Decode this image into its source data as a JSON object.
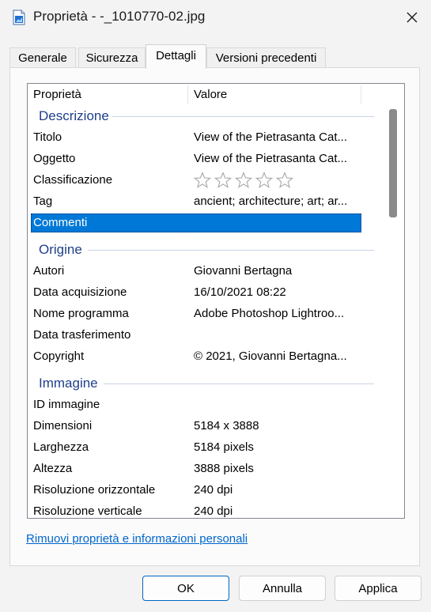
{
  "window": {
    "title": "Proprietà - -_1010770-02.jpg",
    "icon": "image-file-icon"
  },
  "tabs": [
    {
      "label": "Generale",
      "active": false
    },
    {
      "label": "Sicurezza",
      "active": false
    },
    {
      "label": "Dettagli",
      "active": true
    },
    {
      "label": "Versioni precedenti",
      "active": false
    }
  ],
  "list": {
    "header": {
      "property": "Proprietà",
      "value": "Valore"
    },
    "groups": {
      "descrizione": "Descrizione",
      "origine": "Origine",
      "immagine": "Immagine"
    },
    "rows": [
      {
        "name": "Titolo",
        "value": "View of the Pietrasanta Cat..."
      },
      {
        "name": "Oggetto",
        "value": "View of the Pietrasanta Cat..."
      },
      {
        "name": "Classificazione",
        "value": "",
        "rating": 0,
        "rating_max": 5
      },
      {
        "name": "Tag",
        "value": "ancient; architecture; art; ar..."
      },
      {
        "name": "Commenti",
        "value": "",
        "selected": true
      },
      {
        "name": "Autori",
        "value": "Giovanni Bertagna"
      },
      {
        "name": "Data acquisizione",
        "value": "16/10/2021 08:22"
      },
      {
        "name": "Nome programma",
        "value": "Adobe Photoshop Lightroo..."
      },
      {
        "name": "Data trasferimento",
        "value": ""
      },
      {
        "name": "Copyright",
        "value": "© 2021, Giovanni Bertagna..."
      },
      {
        "name": "ID immagine",
        "value": ""
      },
      {
        "name": "Dimensioni",
        "value": "5184 x 3888"
      },
      {
        "name": "Larghezza",
        "value": "5184 pixels"
      },
      {
        "name": "Altezza",
        "value": "3888 pixels"
      },
      {
        "name": "Risoluzione orizzontale",
        "value": "240 dpi"
      },
      {
        "name": "Risoluzione verticale",
        "value": "240 dpi"
      }
    ]
  },
  "remove_link": "Rimuovi proprietà e informazioni personali",
  "buttons": {
    "ok": "OK",
    "cancel": "Annulla",
    "apply": "Applica"
  },
  "colors": {
    "selection": "#0078d7",
    "group_header": "#1e3f8a",
    "link": "#0066cc",
    "accent_border": "#0067c0"
  }
}
